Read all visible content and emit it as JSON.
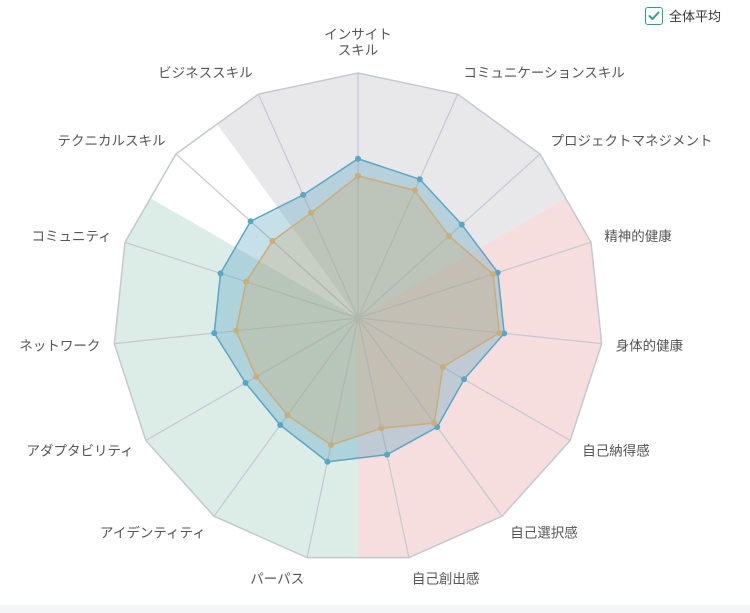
{
  "legend": {
    "label": "全体平均",
    "checked": true
  },
  "chart_data": {
    "type": "radar",
    "categories": [
      "インサイト\nスキル",
      "コミュニケーションスキル",
      "プロジェクトマネジメント",
      "精神的健康",
      "身体的健康",
      "自己納得感",
      "自己選択感",
      "自己創出感",
      "パーパス",
      "アイデンティティ",
      "アダプタビリティ",
      "ネットワーク",
      "コミュニティ",
      "テクニカルスキル",
      "ビジネススキル"
    ],
    "range": [
      0,
      1
    ],
    "rings": 5,
    "sectors": [
      {
        "from": 13.5,
        "to": 2.5,
        "color": "#e8e8ea"
      },
      {
        "from": 2.5,
        "to": 7.5,
        "color": "#f6dede"
      },
      {
        "from": 7.5,
        "to": 12.5,
        "color": "#dcece7"
      }
    ],
    "series": [
      {
        "values": [
          0.65,
          0.62,
          0.57,
          0.6,
          0.6,
          0.5,
          0.55,
          0.57,
          0.6,
          0.54,
          0.53,
          0.59,
          0.59,
          0.59,
          0.55
        ],
        "color": "#5ba6c2",
        "fill": "#5ba6c2",
        "fill_opacity": 0.35
      },
      {
        "values": [
          0.58,
          0.57,
          0.5,
          0.58,
          0.58,
          0.4,
          0.53,
          0.46,
          0.53,
          0.49,
          0.48,
          0.5,
          0.48,
          0.47,
          0.47
        ],
        "color": "#c9ad7b",
        "fill": "#c9ad7b",
        "fill_opacity": 0.35
      }
    ]
  }
}
